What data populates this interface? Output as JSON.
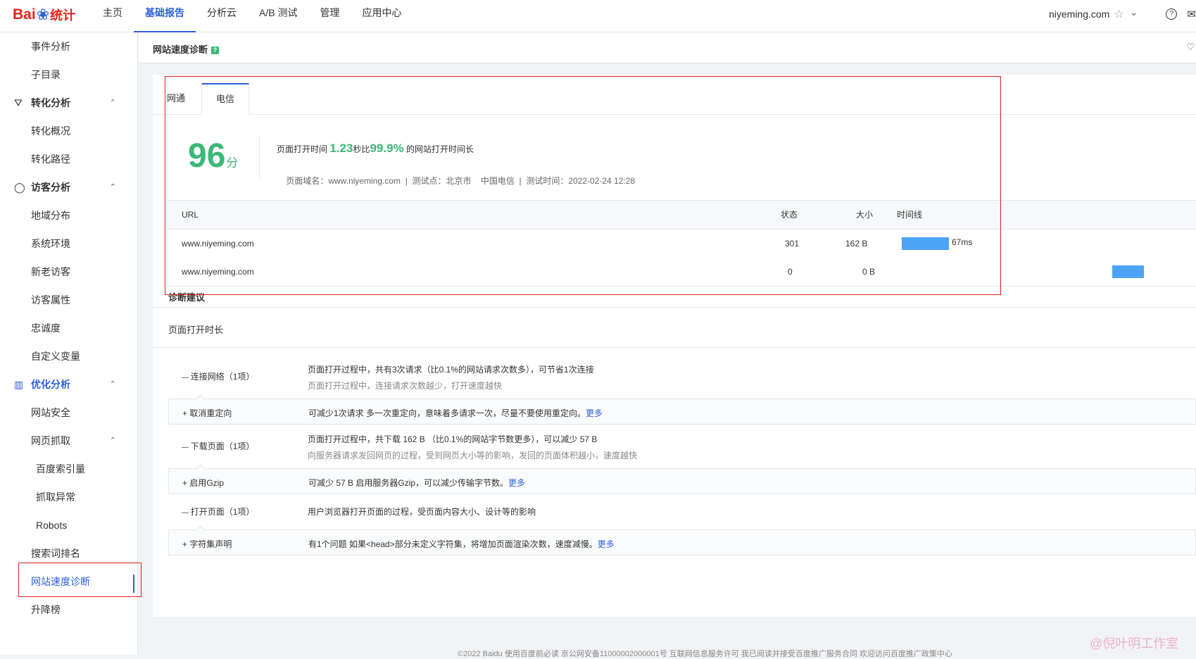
{
  "logo": {
    "text_bai": "Bai",
    "text_tongji": "统计"
  },
  "nav": [
    "主页",
    "基础报告",
    "分析云",
    "A/B 测试",
    "管理",
    "应用中心"
  ],
  "nav_active": 1,
  "user": {
    "name": "niyeming.com"
  },
  "icons": {
    "star": "☆",
    "chevron": "⌄",
    "help": "?",
    "mail": "✉",
    "heart": "♡"
  },
  "sidebar": {
    "items": [
      {
        "label": "事件分析",
        "type": "item"
      },
      {
        "label": "子目录",
        "type": "item"
      },
      {
        "label": "转化分析",
        "type": "group",
        "icon": "funnel-icon"
      },
      {
        "label": "转化概况",
        "type": "item"
      },
      {
        "label": "转化路径",
        "type": "item"
      },
      {
        "label": "访客分析",
        "type": "group",
        "icon": "person-icon"
      },
      {
        "label": "地域分布",
        "type": "item"
      },
      {
        "label": "系统环境",
        "type": "item"
      },
      {
        "label": "新老访客",
        "type": "item"
      },
      {
        "label": "访客属性",
        "type": "item"
      },
      {
        "label": "忠诚度",
        "type": "item"
      },
      {
        "label": "自定义变量",
        "type": "item"
      },
      {
        "label": "优化分析",
        "type": "group",
        "icon": "bar-chart-icon",
        "highlight": true
      },
      {
        "label": "网站安全",
        "type": "item"
      },
      {
        "label": "网页抓取",
        "type": "item",
        "caret": true
      },
      {
        "label": "百度索引量",
        "type": "item2"
      },
      {
        "label": "抓取异常",
        "type": "item2"
      },
      {
        "label": "Robots",
        "type": "item2"
      },
      {
        "label": "搜索词排名",
        "type": "item"
      },
      {
        "label": "网站速度诊断",
        "type": "item",
        "active": true
      },
      {
        "label": "升降榜",
        "type": "item"
      }
    ]
  },
  "page": {
    "title": "网站速度诊断",
    "help_badge": "?"
  },
  "tabs": [
    "网通",
    "电信"
  ],
  "score": {
    "value": "96",
    "unit": "分"
  },
  "summary": {
    "prefix": "页面打开时间 ",
    "time": "1.23",
    "mid": "秒比",
    "percent": "99.9%",
    "suffix": " 的网站打开时间长"
  },
  "meta": {
    "domain_label": "页面域名：",
    "domain": "www.niyeming.com",
    "sep": "  |  ",
    "point_label": "测试点：",
    "point": "北京市    中国电信",
    "time_label": "测试时间：",
    "time": "2022-02-24 12:28"
  },
  "table": {
    "headers": {
      "url": "URL",
      "status": "状态",
      "size": "大小",
      "timeline": "时间线"
    },
    "rows": [
      {
        "url": "www.niyeming.com",
        "status": "301",
        "size": "162 B",
        "time_label": "67ms",
        "bar_start": 0,
        "bar_ms": 67
      },
      {
        "url": "www.niyeming.com",
        "status": "0",
        "size": "0 B",
        "time_label": "",
        "bar_start": 299,
        "bar_ms": 45
      }
    ],
    "timeline_max_ms": 340
  },
  "diagnosis": {
    "title": "诊断建议",
    "subtitle": "页面打开时长",
    "groups": [
      {
        "label": "连接网络（1项）",
        "desc": "页面打开过程中，共有3次请求（比0.1%的网站请求次数多），可节省1次连接",
        "hint": "页面打开过程中，连接请求次数越少，打开速度越快",
        "rule": {
          "label": "取消重定向",
          "desc": "可减少1次请求 多一次重定向，意味着多请求一次，尽量不要使用重定向。",
          "more": "更多"
        }
      },
      {
        "label": "下载页面（1项）",
        "desc": "页面打开过程中，共下载 162 B （比0.1%的网站字节数更多），可以减少 57 B",
        "hint": "向服务器请求发回网页的过程，受到网页大小等的影响，发回的页面体积越小，速度越快",
        "rule": {
          "label": "启用Gzip",
          "desc": "可减少 57 B 启用服务器Gzip，可以减少传输字节数。",
          "more": "更多"
        }
      },
      {
        "label": "打开页面（1项）",
        "desc": "用户浏览器打开页面的过程，受页面内容大小、设计等的影响",
        "hint": "",
        "rule": {
          "label": "字符集声明",
          "desc": "有1个问题 如果<head>部分未定义字符集，将增加页面渲染次数，速度减慢。",
          "more": "更多"
        }
      }
    ]
  },
  "footer": "©2022 Baidu 使用百度前必读 京公网安备11000002000001号 互联网信息服务许可 我已阅读并接受百度推广服务合同 欢迎访问百度推广政策中心",
  "watermark": "@倪叶明工作室",
  "colors": {
    "accent": "#2d5fd8",
    "score_green": "#3cb878",
    "bar_blue": "#4da3f5",
    "annotation_red": "#e02020"
  }
}
